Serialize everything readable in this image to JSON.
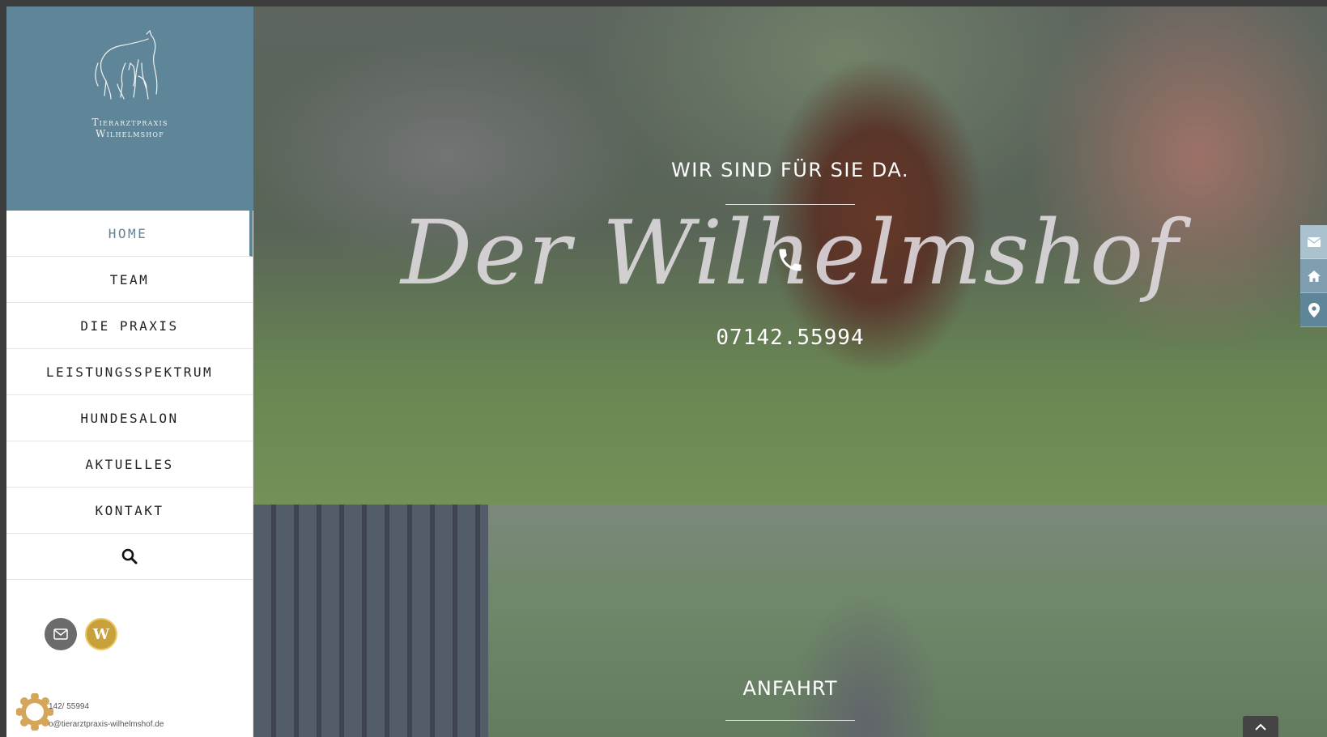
{
  "brand": {
    "logo_line1": "Tierarztpraxis",
    "logo_line2": "Wilhelmshof"
  },
  "nav": {
    "items": [
      {
        "label": "HOME",
        "active": true
      },
      {
        "label": "TEAM"
      },
      {
        "label": "DIE PRAXIS"
      },
      {
        "label": "LEISTUNGSSPEKTRUM"
      },
      {
        "label": "HUNDESALON"
      },
      {
        "label": "AKTUELLES"
      },
      {
        "label": "KONTAKT"
      }
    ],
    "search_icon": "search-icon"
  },
  "social": {
    "mail_icon": "mail-icon",
    "w_label": "W"
  },
  "contact": {
    "phone": "142/ 55994",
    "email": "o@tierarztpraxis-wilhelmshof.de"
  },
  "hero": {
    "title": "WIR SIND FÜR SIE DA.",
    "script": "Der Wilhelmshof",
    "phone": "07142.55994"
  },
  "section2": {
    "title": "ANFAHRT"
  },
  "colors": {
    "brand": "#5f8698",
    "gold": "#c9a13a"
  }
}
